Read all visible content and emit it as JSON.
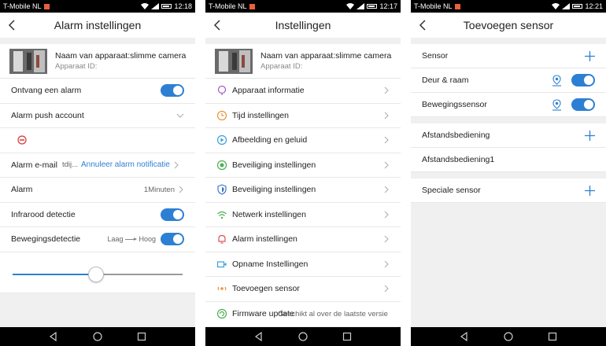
{
  "status_bars": [
    {
      "carrier": "T-Mobile  NL",
      "time": "12:18"
    },
    {
      "carrier": "T-Mobile  NL",
      "time": "12:17"
    },
    {
      "carrier": "T-Mobile  NL",
      "time": "12:21"
    }
  ],
  "screen1": {
    "title": "Alarm instellingen",
    "device_name": "Naam van apparaat:slimme camera",
    "device_id": "Apparaat ID:",
    "rows": {
      "receive_alarm": "Ontvang een alarm",
      "push_account": "Alarm push account",
      "email_label": "Alarm e-mail",
      "email_value": "tdij...",
      "email_link": "Annuleer alarm notificatie",
      "alarm_label": "Alarm",
      "alarm_value": "1Minuten",
      "infrared": "Infrarood detectie",
      "motion": "Bewegingsdetectie",
      "sens_low": "Laag",
      "sens_high": "Hoog"
    },
    "toggles": {
      "receive_alarm": true,
      "infrared": true,
      "motion": true
    },
    "sensitivity_fraction": 0.49
  },
  "screen2": {
    "title": "Instellingen",
    "device_name": "Naam van apparaat:slimme camera",
    "device_id": "Apparaat ID:",
    "items": [
      {
        "label": "Apparaat informatie",
        "icon": "info-icon",
        "color": "#a259c4"
      },
      {
        "label": "Tijd instellingen",
        "icon": "clock-icon",
        "color": "#e8943a"
      },
      {
        "label": "Afbeelding en geluid",
        "icon": "play-icon",
        "color": "#3aa0d8"
      },
      {
        "label": "Beveiliging instellingen",
        "icon": "security-icon",
        "color": "#4caf50"
      },
      {
        "label": "Beveiliging instellingen",
        "icon": "shield-icon",
        "color": "#3a78c8"
      },
      {
        "label": "Netwerk instellingen",
        "icon": "wifi-icon",
        "color": "#4caf50"
      },
      {
        "label": "Alarm instellingen",
        "icon": "bell-icon",
        "color": "#e05050"
      },
      {
        "label": "Opname Instellingen",
        "icon": "camera-icon",
        "color": "#3aa0d8"
      },
      {
        "label": "Toevoegen sensor",
        "icon": "sensor-icon",
        "color": "#e8943a"
      }
    ],
    "firmware": {
      "label": "Firmware update",
      "value": "Geschikt al over de laatste versie",
      "icon": "firmware-icon",
      "color": "#4caf50"
    }
  },
  "screen3": {
    "title": "Toevoegen sensor",
    "sensor_header": "Sensor",
    "sensors": [
      "Deur & raam",
      "Bewegingssensor"
    ],
    "remote_header": "Afstandsbediening",
    "remotes": [
      "Afstandsbediening1"
    ],
    "special_header": "Speciale sensor"
  },
  "colors": {
    "accent": "#2d7fd3"
  }
}
